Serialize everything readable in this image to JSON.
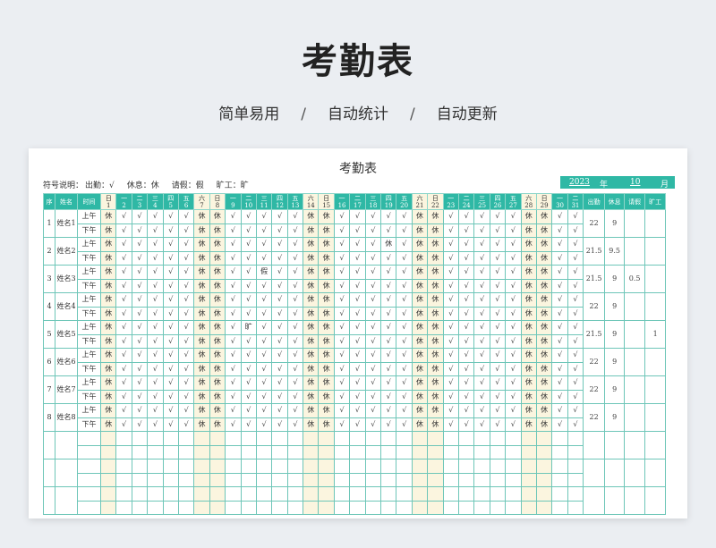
{
  "header": {
    "title": "考勤表",
    "subtitle": [
      "简单易用",
      "自动统计",
      "自动更新"
    ],
    "separator": "/"
  },
  "sheet": {
    "title": "考勤表",
    "legend": {
      "label": "符号说明：",
      "items": [
        "出勤：√",
        "休息：休",
        "请假：假",
        "旷工：旷"
      ]
    },
    "year": "2023",
    "year_unit": "年",
    "month": "10",
    "month_unit": "月",
    "columns": {
      "index": "序",
      "name": "姓名",
      "time": "时间",
      "attendance": "出勤",
      "rest": "休息",
      "leave": "请假",
      "absent": "旷工"
    },
    "weekdays": [
      "日",
      "一",
      "二",
      "三",
      "四",
      "五",
      "六",
      "日",
      "一",
      "二",
      "三",
      "四",
      "五",
      "六",
      "日",
      "一",
      "二",
      "三",
      "四",
      "五",
      "六",
      "日",
      "一",
      "二",
      "三",
      "四",
      "五",
      "六",
      "日",
      "一",
      "二"
    ],
    "days": [
      "1",
      "2",
      "3",
      "4",
      "5",
      "6",
      "7",
      "8",
      "9",
      "10",
      "11",
      "12",
      "13",
      "14",
      "15",
      "16",
      "17",
      "18",
      "19",
      "20",
      "21",
      "22",
      "23",
      "24",
      "25",
      "26",
      "27",
      "28",
      "29",
      "30",
      "31"
    ],
    "periods": [
      "上午",
      "下午"
    ],
    "symbols": {
      "present": "√",
      "rest": "休",
      "leave": "假",
      "absent": "旷"
    },
    "employees": [
      {
        "index": "1",
        "name": "姓名1",
        "attendance": "22",
        "rest": "9",
        "leave": "",
        "absent": "",
        "am": "休√√√√√休休√√√√√休休√√√√√休休√√√√√休休√√",
        "pm": "休√√√√√休休√√√√√休休√√√√√休休√√√√√休休√√"
      },
      {
        "index": "2",
        "name": "姓名2",
        "attendance": "21.5",
        "rest": "9.5",
        "leave": "",
        "absent": "",
        "am": "休√√√√√休休√√√√√休休√√√休√休休√√√√√休休√√",
        "pm": "休√√√√√休休√√√√√休休√√√√√休休√√√√√休休√√"
      },
      {
        "index": "3",
        "name": "姓名3",
        "attendance": "21.5",
        "rest": "9",
        "leave": "0.5",
        "absent": "",
        "am": "休√√√√√休休√√假√√休休√√√√√休休√√√√√休休√√",
        "pm": "休√√√√√休休√√√√√休休√√√√√休休√√√√√休休√√"
      },
      {
        "index": "4",
        "name": "姓名4",
        "attendance": "22",
        "rest": "9",
        "leave": "",
        "absent": "",
        "am": "休√√√√√休休√√√√√休休√√√√√休休√√√√√休休√√",
        "pm": "休√√√√√休休√√√√√休休√√√√√休休√√√√√休休√√"
      },
      {
        "index": "5",
        "name": "姓名5",
        "attendance": "21.5",
        "rest": "9",
        "leave": "",
        "absent": "1",
        "am": "休√√√√√休休√旷√√√休休√√√√√休休√√√√√休休√√",
        "pm": "休√√√√√休休√√√√√休休√√√√√休休√√√√√休休√√"
      },
      {
        "index": "6",
        "name": "姓名6",
        "attendance": "22",
        "rest": "9",
        "leave": "",
        "absent": "",
        "am": "休√√√√√休休√√√√√休休√√√√√休休√√√√√休休√√",
        "pm": "休√√√√√休休√√√√√休休√√√√√休休√√√√√休休√√"
      },
      {
        "index": "7",
        "name": "姓名7",
        "attendance": "22",
        "rest": "9",
        "leave": "",
        "absent": "",
        "am": "休√√√√√休休√√√√√休休√√√√√休休√√√√√休休√√",
        "pm": "休√√√√√休休√√√√√休休√√√√√休休√√√√√休休√√"
      },
      {
        "index": "8",
        "name": "姓名8",
        "attendance": "22",
        "rest": "9",
        "leave": "",
        "absent": "",
        "am": "休√√√√√休休√√√√√休休√√√√√休休√√√√√休休√√",
        "pm": "休√√√√√休休√√√√√休休√√√√√休休√√√√√休休√√"
      }
    ],
    "empty_row_pairs": 3
  },
  "colors": {
    "accent": "#2fb8a5",
    "grid": "#6ec6b8",
    "weekend": "#fbf5df"
  }
}
